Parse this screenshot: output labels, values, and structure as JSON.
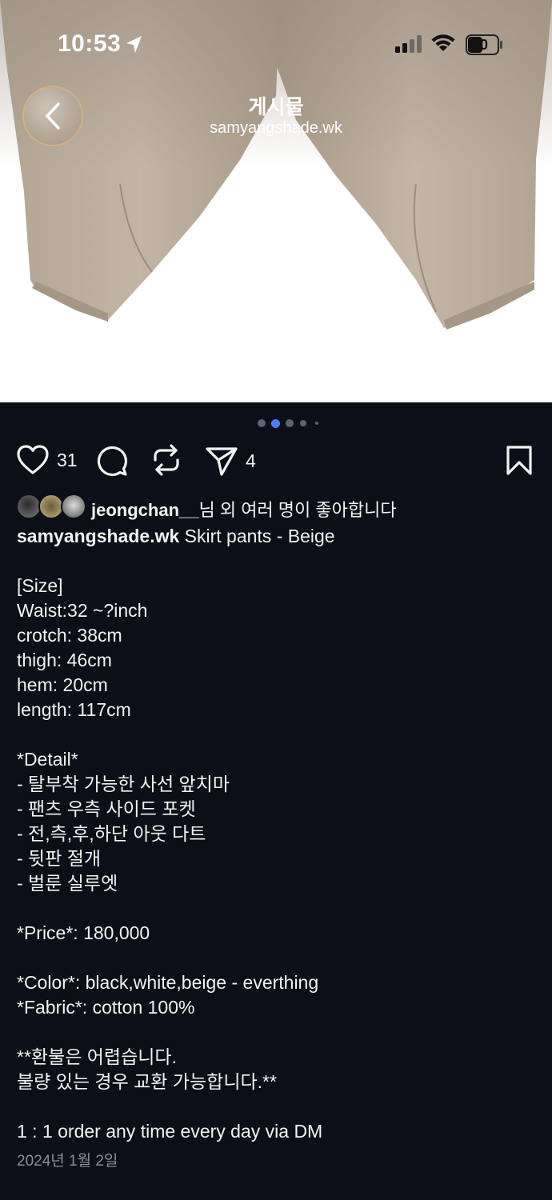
{
  "status_bar": {
    "time": "10:53",
    "battery": "50"
  },
  "nav": {
    "title": "게시물",
    "subtitle": "samyangshade.wk",
    "back_icon": "chevron-left-icon"
  },
  "carousel": {
    "total": 5,
    "active": 1
  },
  "actions": {
    "like_count": "31",
    "share_count": "4",
    "icons": [
      "heart-icon",
      "comment-icon",
      "repost-icon",
      "send-icon",
      "bookmark-icon"
    ]
  },
  "likes": {
    "username": "jeongchan__",
    "suffix": "님 외 여러 명이 좋아합니다"
  },
  "caption": {
    "author": "samyangshade.wk",
    "title": " Skirt pants - Beige",
    "lines": [
      "",
      "[Size]",
      "Waist:32 ~?inch",
      "crotch: 38cm",
      "thigh: 46cm",
      "hem: 20cm",
      "length: 117cm",
      "",
      "*Detail*",
      "- 탈부착 가능한 사선 앞치마",
      "- 팬츠 우측 사이드 포켓",
      "- 전,측,후,하단 아웃 다트",
      "- 뒷판 절개",
      "- 벌룬 실루엣",
      "",
      "*Price*: 180,000",
      "",
      "*Color*: black,white,beige - everthing",
      "*Fabric*: cotton 100%",
      "",
      "**환불은 어렵습니다.",
      "불량 있는 경우 교환 가능합니다.**",
      "",
      "1 : 1 order any time every day via DM"
    ]
  },
  "date": "2024년 1월 2일",
  "colors": {
    "background": "#0c0f17",
    "text": "#f2f2f2",
    "muted": "#8a8e96",
    "fabric": "#bfb1a0"
  }
}
